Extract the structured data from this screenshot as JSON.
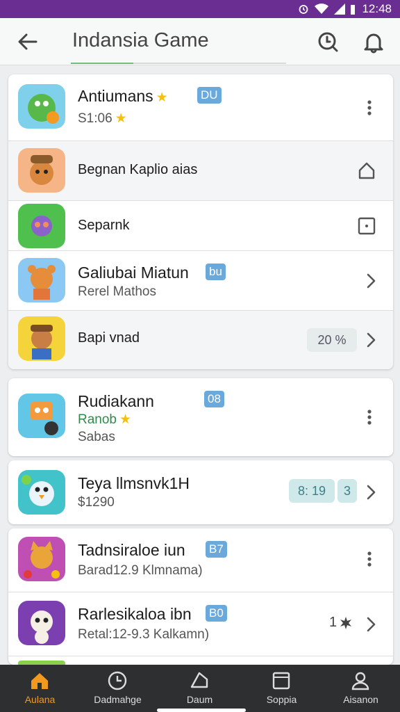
{
  "status_bar": {
    "time": "12:48"
  },
  "header": {
    "title": "Indansia Game",
    "back_icon": "arrow-left-icon",
    "actions": [
      "search-clock-icon",
      "bell-icon"
    ]
  },
  "groups": [
    {
      "rows": [
        {
          "name": "Antiumans",
          "sub": "S1:06",
          "badge": "DU",
          "trail": "more-vert-icon"
        },
        {
          "name": "Begnan Kaplio aias",
          "trail": "house-icon"
        },
        {
          "name": "Separnk",
          "trail": "square-dot-icon"
        },
        {
          "name": "Galiubai Miatun",
          "sub": "Rerel Mathos",
          "badge": "bu",
          "trail": "chevron-right-icon"
        },
        {
          "name": "Bapi vnad",
          "pill": "20 %",
          "trail": "chevron-right-icon"
        }
      ]
    },
    {
      "rows": [
        {
          "name": "Rudiakann",
          "sub_green": "Ranob",
          "sub": "Sabas",
          "badge": "08",
          "trail": "more-vert-icon"
        }
      ]
    },
    {
      "rows": [
        {
          "name": "Teya llmsnvk1H",
          "sub": "$1290",
          "pill": "8: 19",
          "pill2": "3",
          "trail": "chevron-right-icon"
        }
      ]
    },
    {
      "rows": [
        {
          "name": "Tadnsiraloe iun",
          "sub": "Barad12.9 Klmnama)",
          "badge": "B7",
          "trail": "more-vert-icon"
        },
        {
          "name": "Rarlesikaloa ibn",
          "sub": "Retal:12-9.3 Kalkamn)",
          "badge": "B0",
          "count": "1",
          "trail": "chevron-right-icon"
        }
      ]
    }
  ],
  "bottom_nav": [
    {
      "label": "Aulana",
      "icon": "home-icon",
      "active": true
    },
    {
      "label": "Dadmahge",
      "icon": "clock-icon",
      "active": false
    },
    {
      "label": "Daum",
      "icon": "shape-icon",
      "active": false
    },
    {
      "label": "Soppia",
      "icon": "square-icon",
      "active": false
    },
    {
      "label": "Aisanon",
      "icon": "person-icon",
      "active": false
    }
  ],
  "colors": {
    "status_bar": "#6a2d91",
    "accent": "#f29a1c",
    "badge": "#6aa9dc",
    "nav_bg": "#2d2f31"
  }
}
